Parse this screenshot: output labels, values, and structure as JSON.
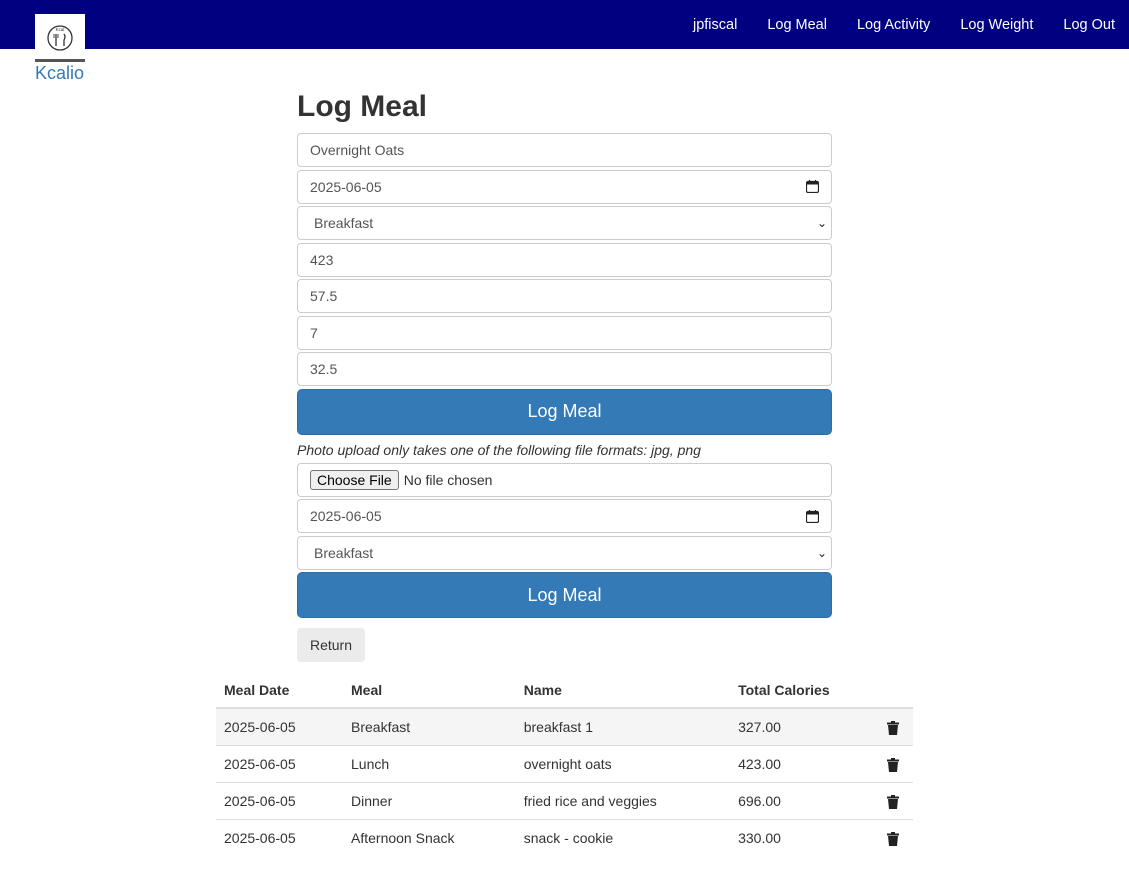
{
  "navbar": {
    "links": [
      "jpfiscal",
      "Log Meal",
      "Log Activity",
      "Log Weight",
      "Log Out"
    ],
    "brand": "Kcalio",
    "logo_text": "Kcal"
  },
  "form": {
    "title": "Log Meal",
    "meal_name": "Overnight Oats",
    "date": "2025-06-05",
    "meal_type": "Breakfast",
    "calories": "423",
    "carbs": "57.5",
    "fat": "7",
    "protein": "32.5",
    "submit_label": "Log Meal"
  },
  "photo_form": {
    "help_text": "Photo upload only takes one of the following file formats: jpg, png",
    "choose_file_label": "Choose File",
    "file_status": "No file chosen",
    "date": "2025-06-05",
    "meal_type": "Breakfast",
    "submit_label": "Log Meal"
  },
  "return_label": "Return",
  "table": {
    "headers": [
      "Meal Date",
      "Meal",
      "Name",
      "Total Calories"
    ],
    "rows": [
      {
        "date": "2025-06-05",
        "meal": "Breakfast",
        "name": "breakfast 1",
        "calories": "327.00"
      },
      {
        "date": "2025-06-05",
        "meal": "Lunch",
        "name": "overnight oats",
        "calories": "423.00"
      },
      {
        "date": "2025-06-05",
        "meal": "Dinner",
        "name": "fried rice and veggies",
        "calories": "696.00"
      },
      {
        "date": "2025-06-05",
        "meal": "Afternoon Snack",
        "name": "snack - cookie",
        "calories": "330.00"
      }
    ]
  },
  "colors": {
    "navbar": "#000080",
    "primary": "#337ab7",
    "brand": "#337ab7"
  },
  "icons": [
    "calendar-icon",
    "chevron-down-icon",
    "trash-icon",
    "logo-icon"
  ]
}
